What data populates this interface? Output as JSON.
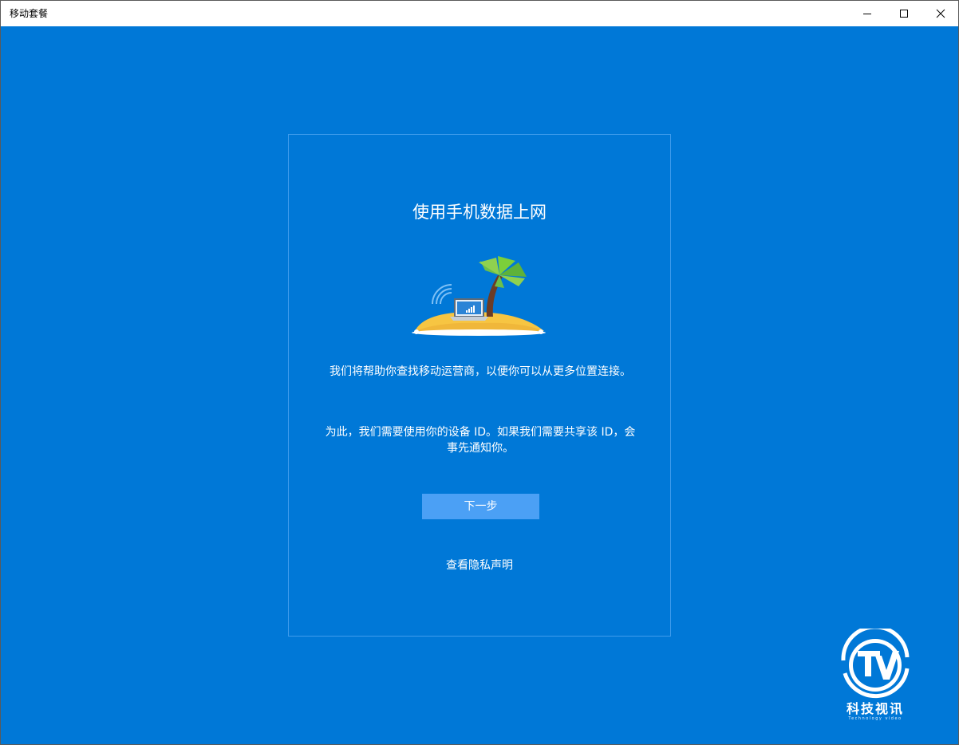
{
  "window": {
    "title": "移动套餐",
    "minimize_icon": "minimize-icon",
    "maximize_icon": "maximize-icon",
    "close_icon": "close-icon"
  },
  "colors": {
    "background": "#0078d7",
    "panel_border": "#3f9cec",
    "button": "#4ba0f5",
    "titlebar": "#ffffff"
  },
  "main": {
    "heading": "使用手机数据上网",
    "illustration": "island-palm-tree-laptop-illustration",
    "paragraph_1": "我们将帮助你查找移动运营商，以便你可以从更多位置连接。",
    "paragraph_2": "为此，我们需要使用你的设备 ID。如果我们需要共享该 ID，会事先通知你。",
    "next_button_label": "下一步",
    "privacy_link_label": "查看隐私声明"
  },
  "watermark": {
    "logo_text": "TV",
    "name": "科技视讯",
    "subtitle": "Technology video"
  }
}
